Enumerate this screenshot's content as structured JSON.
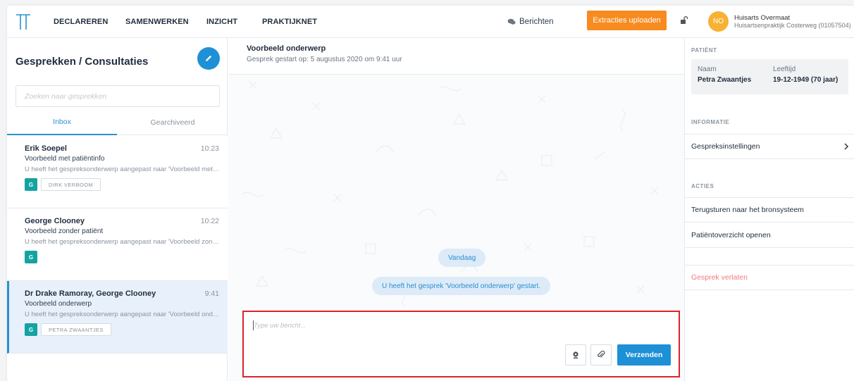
{
  "nav": {
    "items": [
      "DECLAREREN",
      "SAMENWERKEN",
      "INZICHT",
      "PRAKTIJKNET"
    ],
    "messages_label": "Berichten",
    "upload_label": "Extracties uploaden",
    "avatar_initials": "NO",
    "user_name": "Huisarts Overmaat",
    "user_org": "Huisartsenpraktijk Costerweg (01057504)"
  },
  "left": {
    "title": "Gesprekken / Consultaties",
    "search_placeholder": "Zoeken naar gesprekken",
    "tabs": [
      "Inbox",
      "Gearchiveerd"
    ],
    "conversations": [
      {
        "name": "Erik Soepel",
        "time": "10:23",
        "subject": "Voorbeeld met patiëntinfo",
        "preview": "U heeft het gespreksonderwerp aangepast naar 'Voorbeeld met patiëntinfo'.",
        "badge": "G",
        "tag": "DIRK VERBOOM"
      },
      {
        "name": "George Clooney",
        "time": "10:22",
        "subject": "Voorbeeld zonder patiënt",
        "preview": "U heeft het gespreksonderwerp aangepast naar 'Voorbeeld zonder patiënt'.",
        "badge": "G",
        "tag": ""
      },
      {
        "name": "Dr Drake Ramoray, George Clooney",
        "time": "9:41",
        "subject": "Voorbeeld onderwerp",
        "preview": "U heeft het gespreksonderwerp aangepast naar 'Voorbeeld onderwerp'.",
        "badge": "G",
        "tag": "PETRA ZWAANTJES"
      }
    ]
  },
  "center": {
    "title": "Voorbeeld onderwerp",
    "started": "Gesprek gestart op: 5 augustus 2020 om 9:41 uur",
    "today_chip": "Vandaag",
    "system_message": "U heeft het gesprek 'Voorbeeld onderwerp' gestart.",
    "compose_placeholder": "Type uw bericht...",
    "send_label": "Verzenden"
  },
  "right": {
    "patient_label": "PATIËNT",
    "name_label": "Naam",
    "name_value": "Petra Zwaantjes",
    "age_label": "Leeftijd",
    "age_value": "19-12-1949 (70 jaar)",
    "info_label": "INFORMATIE",
    "settings_label": "Gespreksinstellingen",
    "actions_label": "ACTIES",
    "action_send_back": "Terugsturen naar het bronsysteem",
    "action_overview": "Patiëntoverzicht openen",
    "leave_label": "Gesprek verlaten"
  },
  "colors": {
    "accent": "#1e90d6",
    "upload": "#f78b1f",
    "badge": "#14a3a3",
    "leave": "#f07a80",
    "highlight_border": "#d9252a"
  }
}
